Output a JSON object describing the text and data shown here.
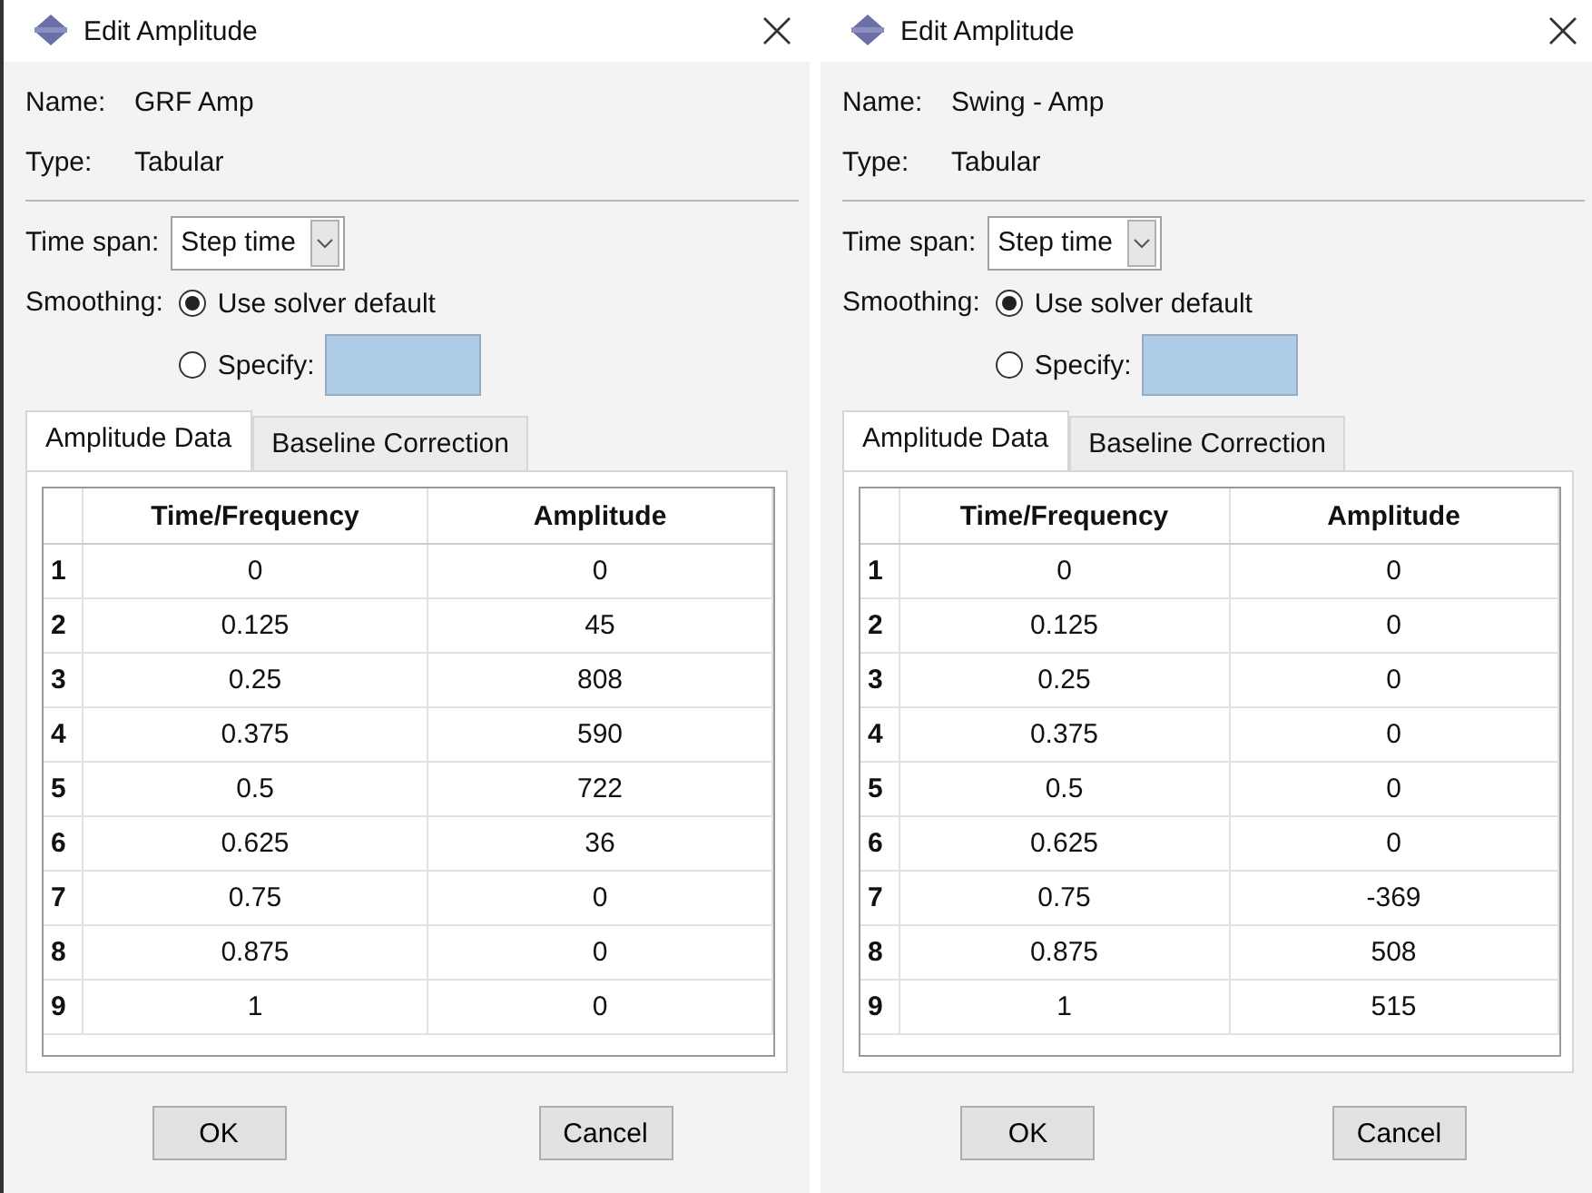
{
  "dialogs": [
    {
      "title": "Edit Amplitude",
      "name_label": "Name:",
      "name": "GRF Amp",
      "type_label": "Type:",
      "type": "Tabular",
      "time_span_label": "Time span:",
      "time_span": "Step time",
      "smoothing_label": "Smoothing:",
      "smoothing_options": [
        {
          "kind": "radio",
          "label": "Use solver default",
          "selected": true
        },
        {
          "kind": "radio_with_field",
          "label": "Specify:",
          "selected": false
        }
      ],
      "tabs": [
        {
          "label": "Amplitude Data",
          "selected": true
        },
        {
          "label": "Baseline Correction",
          "selected": false
        }
      ],
      "columns": [
        "Time/Frequency",
        "Amplitude"
      ],
      "rows": [
        {
          "index": "1",
          "time": "0",
          "amplitude": "0"
        },
        {
          "index": "2",
          "time": "0.125",
          "amplitude": "45"
        },
        {
          "index": "3",
          "time": "0.25",
          "amplitude": "808"
        },
        {
          "index": "4",
          "time": "0.375",
          "amplitude": "590"
        },
        {
          "index": "5",
          "time": "0.5",
          "amplitude": "722"
        },
        {
          "index": "6",
          "time": "0.625",
          "amplitude": "36"
        },
        {
          "index": "7",
          "time": "0.75",
          "amplitude": "0"
        },
        {
          "index": "8",
          "time": "0.875",
          "amplitude": "0"
        },
        {
          "index": "9",
          "time": "1",
          "amplitude": "0"
        }
      ],
      "buttons": [
        "OK",
        "Cancel"
      ]
    },
    {
      "title": "Edit Amplitude",
      "name_label": "Name:",
      "name": "Swing - Amp",
      "type_label": "Type:",
      "type": "Tabular",
      "time_span_label": "Time span:",
      "time_span": "Step time",
      "smoothing_label": "Smoothing:",
      "smoothing_options": [
        {
          "kind": "radio",
          "label": "Use solver default",
          "selected": true
        },
        {
          "kind": "radio_with_field",
          "label": "Specify:",
          "selected": false
        }
      ],
      "tabs": [
        {
          "label": "Amplitude Data",
          "selected": true
        },
        {
          "label": "Baseline Correction",
          "selected": false
        }
      ],
      "columns": [
        "Time/Frequency",
        "Amplitude"
      ],
      "rows": [
        {
          "index": "1",
          "time": "0",
          "amplitude": "0"
        },
        {
          "index": "2",
          "time": "0.125",
          "amplitude": "0"
        },
        {
          "index": "3",
          "time": "0.25",
          "amplitude": "0"
        },
        {
          "index": "4",
          "time": "0.375",
          "amplitude": "0"
        },
        {
          "index": "5",
          "time": "0.5",
          "amplitude": "0"
        },
        {
          "index": "6",
          "time": "0.625",
          "amplitude": "0"
        },
        {
          "index": "7",
          "time": "0.75",
          "amplitude": "-369"
        },
        {
          "index": "8",
          "time": "0.875",
          "amplitude": "508"
        },
        {
          "index": "9",
          "time": "1",
          "amplitude": "515"
        }
      ],
      "buttons": [
        "OK",
        "Cancel"
      ]
    }
  ]
}
